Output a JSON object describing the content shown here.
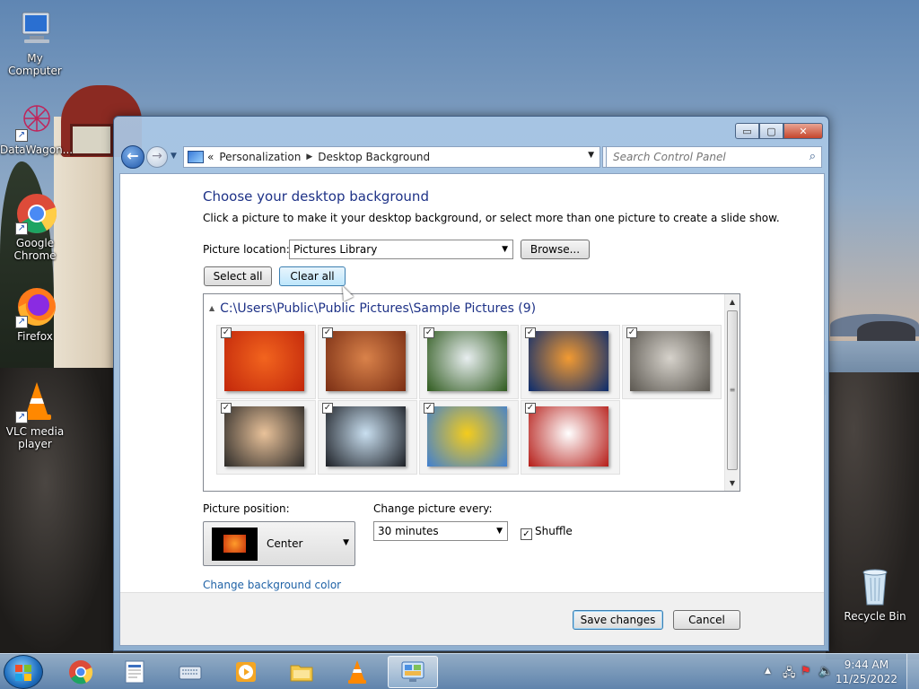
{
  "desktop": {
    "icons": [
      {
        "label": "My Computer",
        "icon": "computer-icon"
      },
      {
        "label": "DataWagon...",
        "icon": "datawagon-icon"
      },
      {
        "label": "Google Chrome",
        "icon": "chrome-icon"
      },
      {
        "label": "Firefox",
        "icon": "firefox-icon"
      },
      {
        "label": "VLC media player",
        "icon": "vlc-icon"
      },
      {
        "label": "Recycle Bin",
        "icon": "recycle-bin-icon"
      }
    ]
  },
  "window": {
    "breadcrumb": [
      "Personalization",
      "Desktop Background"
    ],
    "breadcrumb_prefix": "«",
    "search_placeholder": "Search Control Panel",
    "caption_buttons": [
      "▭",
      "▢",
      "✕"
    ]
  },
  "page": {
    "title": "Choose your desktop background",
    "description": "Click a picture to make it your desktop background, or select more than one picture to create a slide show.",
    "picture_location_label": "Picture location:",
    "picture_location_value": "Pictures Library",
    "browse_label": "Browse...",
    "select_all_label": "Select all",
    "clear_all_label": "Clear all",
    "gallery_title": "C:\\Users\\Public\\Public Pictures\\Sample Pictures (9)",
    "pictures": [
      {
        "name": "Chrysanthemum",
        "checked": true,
        "colors": [
          "#f2641e",
          "#c2270b"
        ]
      },
      {
        "name": "Desert",
        "checked": true,
        "colors": [
          "#d9824a",
          "#7a2e14"
        ]
      },
      {
        "name": "Hydrangeas",
        "checked": true,
        "colors": [
          "#e8eef0",
          "#2f5a1e"
        ]
      },
      {
        "name": "Jellyfish",
        "checked": true,
        "colors": [
          "#f29a32",
          "#0a2b6e"
        ]
      },
      {
        "name": "Koala",
        "checked": true,
        "colors": [
          "#d6d2cb",
          "#5b5750"
        ]
      },
      {
        "name": "Lighthouse",
        "checked": true,
        "colors": [
          "#e9c29a",
          "#2c2a28"
        ]
      },
      {
        "name": "Penguins",
        "checked": true,
        "colors": [
          "#c9dff0",
          "#1c1f25"
        ]
      },
      {
        "name": "Tulips",
        "checked": true,
        "colors": [
          "#f4cc1c",
          "#3f7fd1"
        ]
      },
      {
        "name": "Santa",
        "checked": true,
        "colors": [
          "#ffffff",
          "#b51c17"
        ]
      }
    ],
    "picture_position_label": "Picture position:",
    "picture_position_value": "Center",
    "change_every_label": "Change picture every:",
    "change_every_value": "30 minutes",
    "shuffle_label": "Shuffle",
    "shuffle_checked": true,
    "change_color_link": "Change background color",
    "save_label": "Save changes",
    "cancel_label": "Cancel"
  },
  "taskbar": {
    "items": [
      "chrome-icon",
      "wordpad-icon",
      "keyboard-icon",
      "media-player-icon",
      "explorer-icon",
      "vlc-icon",
      "control-panel-icon"
    ],
    "time": "9:44 AM",
    "date": "11/25/2022"
  },
  "colors": {
    "title_blue": "#1e3287",
    "link_blue": "#1f62a6"
  }
}
